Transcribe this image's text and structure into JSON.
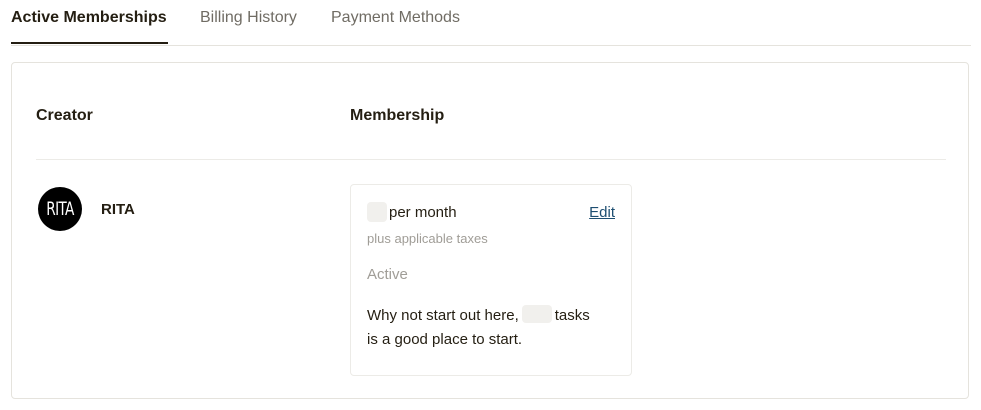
{
  "tabs": [
    {
      "label": "Active Memberships",
      "active": true
    },
    {
      "label": "Billing History",
      "active": false
    },
    {
      "label": "Payment Methods",
      "active": false
    }
  ],
  "table": {
    "headers": {
      "creator": "Creator",
      "membership": "Membership"
    },
    "rows": [
      {
        "creator": {
          "avatar_text": "RITA",
          "name": "RITA"
        },
        "membership": {
          "price_text": "per month",
          "edit_label": "Edit",
          "tax_note": "plus applicable taxes",
          "status": "Active",
          "description_part1": "Why not start out here,",
          "description_part2": "tasks",
          "description_part3": "is a good place to start."
        }
      }
    ]
  },
  "colors": {
    "text_primary": "#241e12",
    "text_secondary": "#706c64",
    "text_muted": "#a09d97",
    "link": "#1d4e71",
    "border": "#e5e3dd",
    "avatar_bg": "#000000"
  }
}
